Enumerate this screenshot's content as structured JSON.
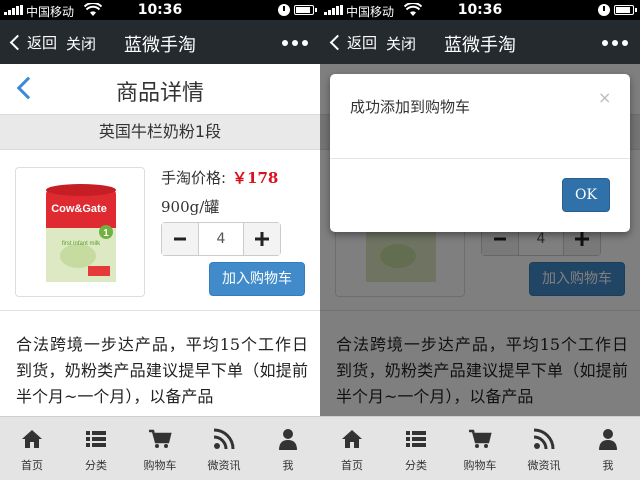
{
  "status_bar": {
    "carrier": "中国移动",
    "time": "10:36"
  },
  "nav": {
    "back_label": "返回",
    "close_label": "关闭",
    "title": "蓝微手淘"
  },
  "page": {
    "title": "商品详情"
  },
  "product": {
    "name": "英国牛栏奶粉1段",
    "price_label": "手淘价格:",
    "price": "￥178",
    "spec": "900g/罐",
    "quantity": "4",
    "add_to_cart_label": "加入购物车",
    "description": "合法跨境一步达产品，平均15个工作日到货，奶粉类产品建议提早下单（如提前半个月~一个月），以备产品",
    "image_brand": "Cow&Gate",
    "image_stage": "1",
    "image_text": "first infant milk"
  },
  "tabbar": [
    {
      "label": "首页",
      "icon": "home-icon"
    },
    {
      "label": "分类",
      "icon": "list-icon"
    },
    {
      "label": "购物车",
      "icon": "cart-icon"
    },
    {
      "label": "微资讯",
      "icon": "rss-icon"
    },
    {
      "label": "我",
      "icon": "user-icon"
    }
  ],
  "modal": {
    "message": "成功添加到购物车",
    "close_glyph": "×",
    "ok_label": "OK"
  },
  "colors": {
    "nav_bg": "#252a2e",
    "primary": "#428bca",
    "price": "#d8121d",
    "tabbar_bg": "#e4e4e4"
  }
}
